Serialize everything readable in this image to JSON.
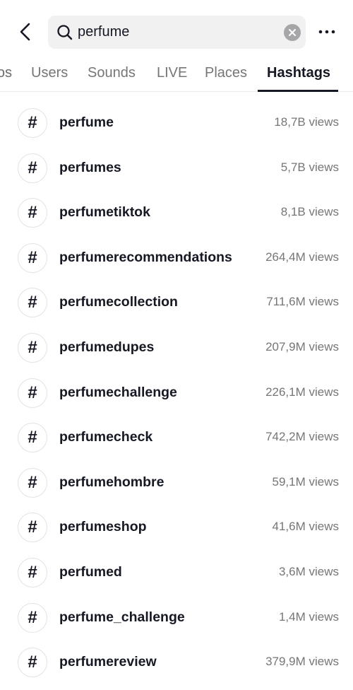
{
  "search": {
    "value": "perfume"
  },
  "tabs": [
    {
      "label": "Videos",
      "visible": "os"
    },
    {
      "label": "Users"
    },
    {
      "label": "Sounds"
    },
    {
      "label": "LIVE"
    },
    {
      "label": "Places"
    },
    {
      "label": "Hashtags",
      "active": true
    }
  ],
  "hashtags": [
    {
      "name": "perfume",
      "views": "18,7B views"
    },
    {
      "name": "perfumes",
      "views": "5,7B views"
    },
    {
      "name": "perfumetiktok",
      "views": "8,1B views"
    },
    {
      "name": "perfumerecommendations",
      "views": "264,4M views"
    },
    {
      "name": "perfumecollection",
      "views": "711,6M views"
    },
    {
      "name": "perfumedupes",
      "views": "207,9M views"
    },
    {
      "name": "perfumechallenge",
      "views": "226,1M views"
    },
    {
      "name": "perfumecheck",
      "views": "742,2M views"
    },
    {
      "name": "perfumehombre",
      "views": "59,1M views"
    },
    {
      "name": "perfumeshop",
      "views": "41,6M views"
    },
    {
      "name": "perfumed",
      "views": "3,6M views"
    },
    {
      "name": "perfume_challenge",
      "views": "1,4M views"
    },
    {
      "name": "perfumereview",
      "views": "379,9M views"
    }
  ],
  "hash_symbol": "#"
}
